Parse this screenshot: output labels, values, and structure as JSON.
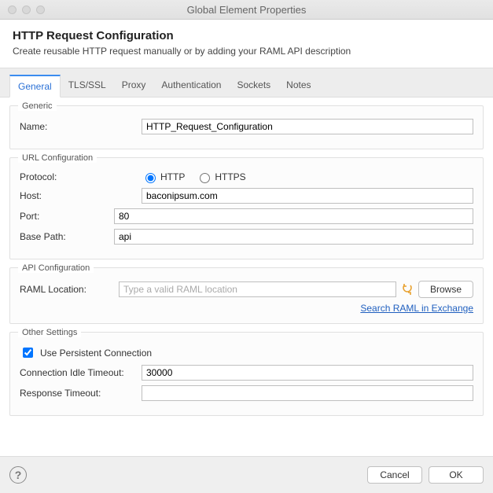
{
  "window": {
    "title": "Global Element Properties"
  },
  "header": {
    "title": "HTTP Request Configuration",
    "subtitle": "Create reusable HTTP request manually or by adding your RAML API description"
  },
  "tabs": {
    "general": "General",
    "tlsssl": "TLS/SSL",
    "proxy": "Proxy",
    "authentication": "Authentication",
    "sockets": "Sockets",
    "notes": "Notes"
  },
  "groups": {
    "generic": {
      "label": "Generic",
      "name_label": "Name:",
      "name_value": "HTTP_Request_Configuration"
    },
    "url": {
      "label": "URL Configuration",
      "protocol_label": "Protocol:",
      "protocol_http": "HTTP",
      "protocol_https": "HTTPS",
      "protocol_selected": "HTTP",
      "host_label": "Host:",
      "host_value": "baconipsum.com",
      "port_label": "Port:",
      "port_value": "80",
      "basepath_label": "Base Path:",
      "basepath_value": "api"
    },
    "api": {
      "label": "API Configuration",
      "raml_label": "RAML Location:",
      "raml_placeholder": "Type a valid RAML location",
      "raml_value": "",
      "browse": "Browse",
      "search_link": "Search RAML in Exchange"
    },
    "other": {
      "label": "Other Settings",
      "persistent_label": "Use Persistent Connection",
      "persistent_checked": true,
      "idle_label": "Connection Idle Timeout:",
      "idle_value": "30000",
      "response_label": "Response Timeout:",
      "response_value": ""
    }
  },
  "footer": {
    "cancel": "Cancel",
    "ok": "OK"
  }
}
